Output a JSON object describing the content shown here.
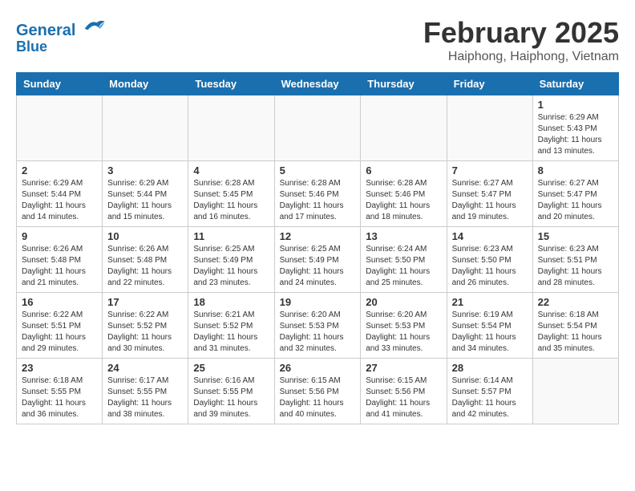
{
  "header": {
    "logo_line1": "General",
    "logo_line2": "Blue",
    "month_year": "February 2025",
    "location": "Haiphong, Haiphong, Vietnam"
  },
  "weekdays": [
    "Sunday",
    "Monday",
    "Tuesday",
    "Wednesday",
    "Thursday",
    "Friday",
    "Saturday"
  ],
  "weeks": [
    [
      {
        "day": "",
        "info": ""
      },
      {
        "day": "",
        "info": ""
      },
      {
        "day": "",
        "info": ""
      },
      {
        "day": "",
        "info": ""
      },
      {
        "day": "",
        "info": ""
      },
      {
        "day": "",
        "info": ""
      },
      {
        "day": "1",
        "info": "Sunrise: 6:29 AM\nSunset: 5:43 PM\nDaylight: 11 hours and 13 minutes."
      }
    ],
    [
      {
        "day": "2",
        "info": "Sunrise: 6:29 AM\nSunset: 5:44 PM\nDaylight: 11 hours and 14 minutes."
      },
      {
        "day": "3",
        "info": "Sunrise: 6:29 AM\nSunset: 5:44 PM\nDaylight: 11 hours and 15 minutes."
      },
      {
        "day": "4",
        "info": "Sunrise: 6:28 AM\nSunset: 5:45 PM\nDaylight: 11 hours and 16 minutes."
      },
      {
        "day": "5",
        "info": "Sunrise: 6:28 AM\nSunset: 5:46 PM\nDaylight: 11 hours and 17 minutes."
      },
      {
        "day": "6",
        "info": "Sunrise: 6:28 AM\nSunset: 5:46 PM\nDaylight: 11 hours and 18 minutes."
      },
      {
        "day": "7",
        "info": "Sunrise: 6:27 AM\nSunset: 5:47 PM\nDaylight: 11 hours and 19 minutes."
      },
      {
        "day": "8",
        "info": "Sunrise: 6:27 AM\nSunset: 5:47 PM\nDaylight: 11 hours and 20 minutes."
      }
    ],
    [
      {
        "day": "9",
        "info": "Sunrise: 6:26 AM\nSunset: 5:48 PM\nDaylight: 11 hours and 21 minutes."
      },
      {
        "day": "10",
        "info": "Sunrise: 6:26 AM\nSunset: 5:48 PM\nDaylight: 11 hours and 22 minutes."
      },
      {
        "day": "11",
        "info": "Sunrise: 6:25 AM\nSunset: 5:49 PM\nDaylight: 11 hours and 23 minutes."
      },
      {
        "day": "12",
        "info": "Sunrise: 6:25 AM\nSunset: 5:49 PM\nDaylight: 11 hours and 24 minutes."
      },
      {
        "day": "13",
        "info": "Sunrise: 6:24 AM\nSunset: 5:50 PM\nDaylight: 11 hours and 25 minutes."
      },
      {
        "day": "14",
        "info": "Sunrise: 6:23 AM\nSunset: 5:50 PM\nDaylight: 11 hours and 26 minutes."
      },
      {
        "day": "15",
        "info": "Sunrise: 6:23 AM\nSunset: 5:51 PM\nDaylight: 11 hours and 28 minutes."
      }
    ],
    [
      {
        "day": "16",
        "info": "Sunrise: 6:22 AM\nSunset: 5:51 PM\nDaylight: 11 hours and 29 minutes."
      },
      {
        "day": "17",
        "info": "Sunrise: 6:22 AM\nSunset: 5:52 PM\nDaylight: 11 hours and 30 minutes."
      },
      {
        "day": "18",
        "info": "Sunrise: 6:21 AM\nSunset: 5:52 PM\nDaylight: 11 hours and 31 minutes."
      },
      {
        "day": "19",
        "info": "Sunrise: 6:20 AM\nSunset: 5:53 PM\nDaylight: 11 hours and 32 minutes."
      },
      {
        "day": "20",
        "info": "Sunrise: 6:20 AM\nSunset: 5:53 PM\nDaylight: 11 hours and 33 minutes."
      },
      {
        "day": "21",
        "info": "Sunrise: 6:19 AM\nSunset: 5:54 PM\nDaylight: 11 hours and 34 minutes."
      },
      {
        "day": "22",
        "info": "Sunrise: 6:18 AM\nSunset: 5:54 PM\nDaylight: 11 hours and 35 minutes."
      }
    ],
    [
      {
        "day": "23",
        "info": "Sunrise: 6:18 AM\nSunset: 5:55 PM\nDaylight: 11 hours and 36 minutes."
      },
      {
        "day": "24",
        "info": "Sunrise: 6:17 AM\nSunset: 5:55 PM\nDaylight: 11 hours and 38 minutes."
      },
      {
        "day": "25",
        "info": "Sunrise: 6:16 AM\nSunset: 5:55 PM\nDaylight: 11 hours and 39 minutes."
      },
      {
        "day": "26",
        "info": "Sunrise: 6:15 AM\nSunset: 5:56 PM\nDaylight: 11 hours and 40 minutes."
      },
      {
        "day": "27",
        "info": "Sunrise: 6:15 AM\nSunset: 5:56 PM\nDaylight: 11 hours and 41 minutes."
      },
      {
        "day": "28",
        "info": "Sunrise: 6:14 AM\nSunset: 5:57 PM\nDaylight: 11 hours and 42 minutes."
      },
      {
        "day": "",
        "info": ""
      }
    ]
  ]
}
